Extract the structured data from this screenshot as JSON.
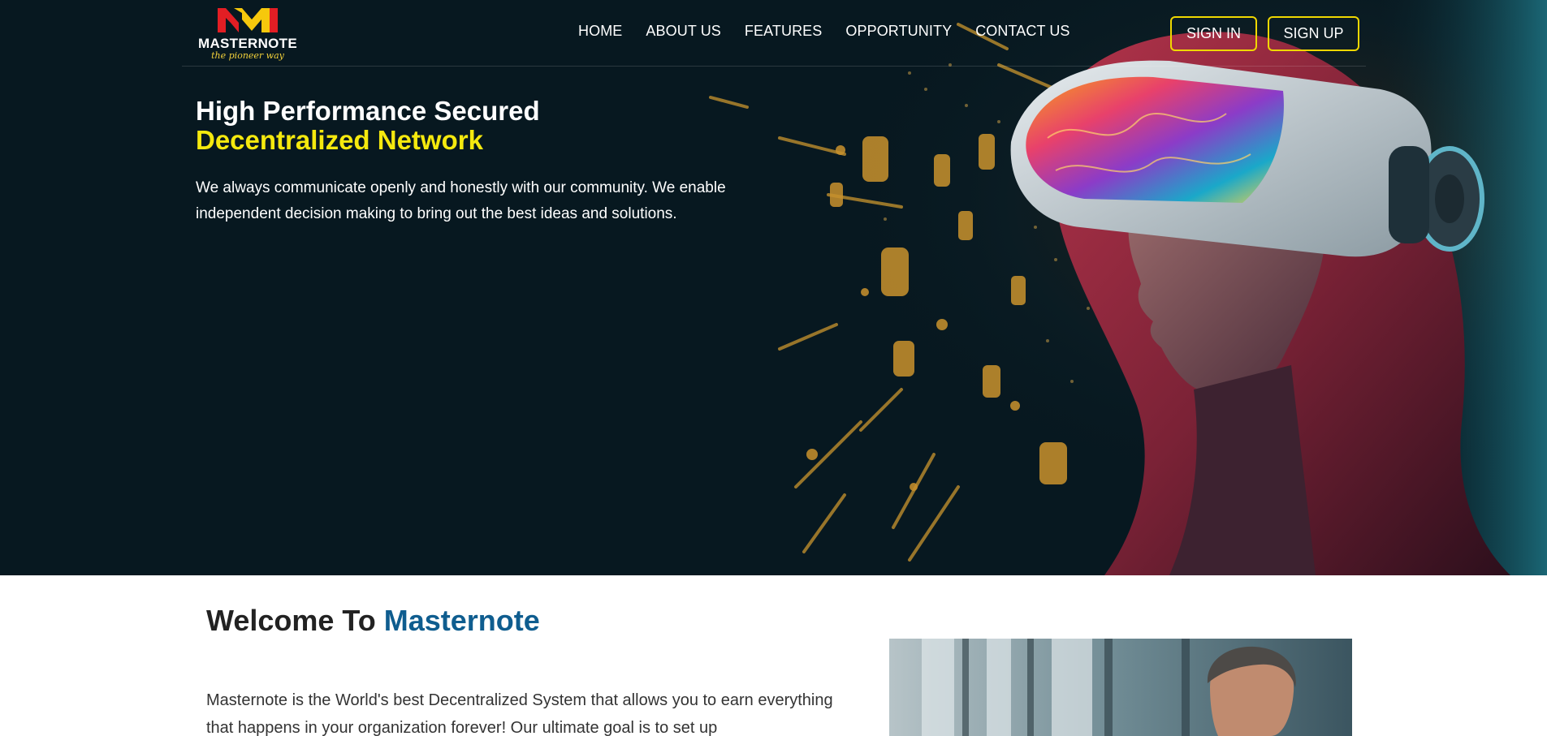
{
  "brand": {
    "name": "MASTERNOTE",
    "tagline": "the pioneer way",
    "logo_colors": {
      "red": "#e31e24",
      "yellow": "#f6c80c"
    }
  },
  "nav": {
    "links": [
      "HOME",
      "ABOUT US",
      "FEATURES",
      "OPPORTUNITY",
      "CONTACT US"
    ],
    "signin_label": "SIGN IN",
    "signup_label": "SIGN UP"
  },
  "hero": {
    "title_line1": "High Performance Secured",
    "title_line2": "Decentralized Network",
    "description": "We always communicate openly and honestly with our community. We enable independent decision making to bring out the best ideas and solutions."
  },
  "welcome": {
    "title_prefix": "Welcome To ",
    "title_brand": "Masternote",
    "text": "Masternote is the World's best Decentralized System that allows you to earn everything that happens in your organization forever! Our ultimate goal is to set up"
  },
  "colors": {
    "hero_bg": "#071820",
    "accent_yellow": "#f5e90e",
    "button_border": "#f0d800",
    "brand_blue": "#0f5d8f"
  }
}
